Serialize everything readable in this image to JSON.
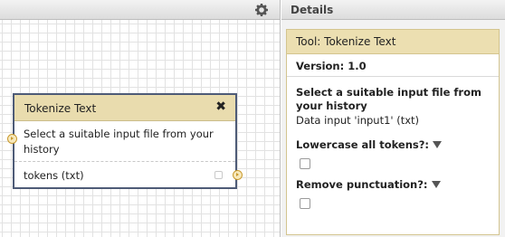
{
  "canvas": {
    "settings_icon": "gear-icon",
    "node": {
      "title": "Tokenize Text",
      "close_icon": "close-icon",
      "close_glyph": "✖",
      "input_label": "Select a suitable input file from your history",
      "output_label": "tokens (txt)"
    }
  },
  "details": {
    "header": "Details",
    "form": {
      "title": "Tool: Tokenize Text",
      "version": "Version: 1.0",
      "params": [
        {
          "label": "Select a suitable input file from your history",
          "value": "Data input 'input1' (txt)"
        },
        {
          "label": "Lowercase all tokens?:",
          "checked": false
        },
        {
          "label": "Remove punctuation?:",
          "checked": false
        }
      ]
    }
  },
  "colors": {
    "node_header": "#e9dcae",
    "node_border": "#4e5b77",
    "terminal": "#c99a2e",
    "form_border": "#d3c48f"
  }
}
